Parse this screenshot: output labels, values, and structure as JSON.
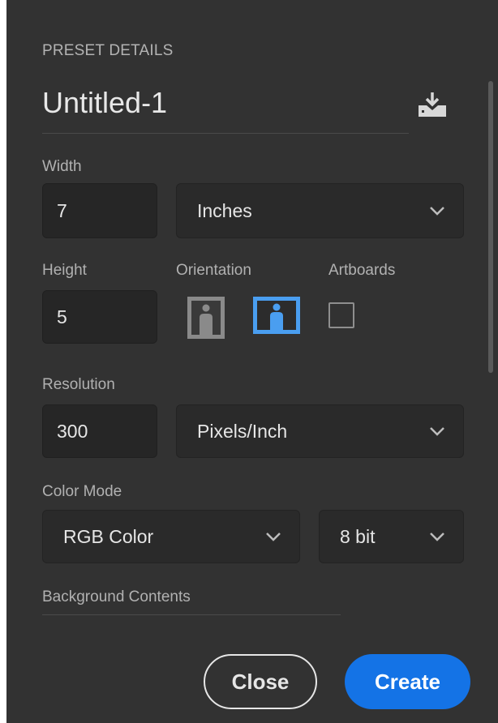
{
  "preset_details": {
    "title": "PRESET DETAILS",
    "document_name": "Untitled-1",
    "save_preset_icon": "save-preset-download-icon"
  },
  "width": {
    "label": "Width",
    "value": "7",
    "unit": "Inches"
  },
  "height": {
    "label": "Height",
    "value": "5"
  },
  "orientation": {
    "label": "Orientation",
    "options": [
      "portrait",
      "landscape"
    ],
    "selected": "landscape",
    "colors": {
      "inactive": "#8a8a8a",
      "active": "#4a9ef0"
    }
  },
  "artboards": {
    "label": "Artboards",
    "checked": false
  },
  "resolution": {
    "label": "Resolution",
    "value": "300",
    "unit": "Pixels/Inch"
  },
  "color_mode": {
    "label": "Color Mode",
    "mode": "RGB Color",
    "bit_depth": "8 bit"
  },
  "background_contents": {
    "label": "Background Contents"
  },
  "buttons": {
    "close": "Close",
    "create": "Create"
  },
  "colors": {
    "panel": "#323232",
    "accent": "#1473e6"
  }
}
